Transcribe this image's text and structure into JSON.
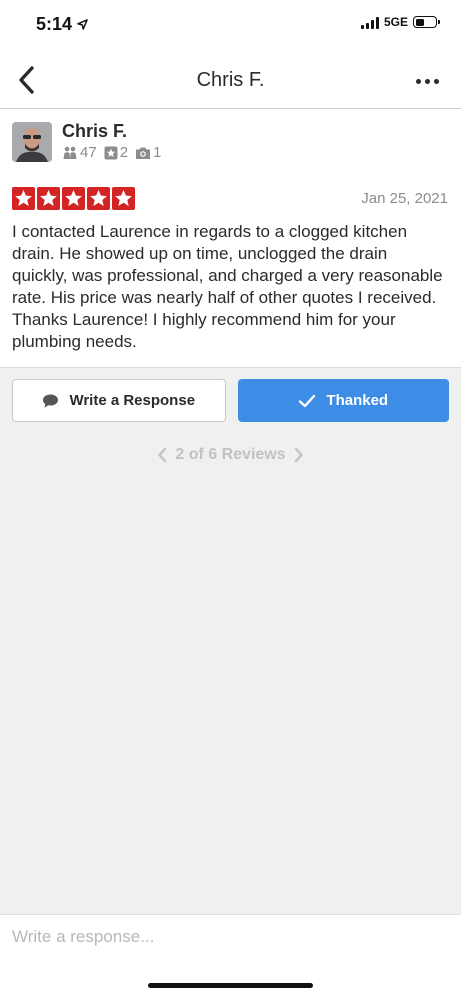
{
  "status_bar": {
    "time": "5:14",
    "network": "5GE",
    "battery_level": 0.45
  },
  "nav": {
    "title": "Chris F."
  },
  "review": {
    "user_name": "Chris F.",
    "stats": {
      "friends": "47",
      "reviews": "2",
      "photos": "1"
    },
    "rating": 5,
    "date": "Jan 25, 2021",
    "text": "I contacted Laurence in regards to a clogged kitchen drain. He showed up on time, unclogged the drain quickly, was professional, and charged a very reasonable rate. His price was nearly half of other quotes I received.  Thanks Laurence! I highly recommend him for your plumbing needs."
  },
  "actions": {
    "write_response_label": "Write a Response",
    "thanked_label": "Thanked"
  },
  "pager": {
    "label": "2 of 6 Reviews"
  },
  "composer": {
    "placeholder": "Write a response..."
  },
  "colors": {
    "star_red": "#d32323",
    "primary_blue": "#3d8de6",
    "muted_gray": "#8c8c8c"
  },
  "icons": {
    "location": "location-arrow-icon",
    "back": "chevron-left-icon",
    "more": "more-dots-icon",
    "friends": "friends-icon",
    "reviews": "review-star-icon",
    "photos": "camera-icon",
    "response": "speech-bubble-icon",
    "thanked": "checkmark-icon",
    "pager_prev": "chevron-left-icon",
    "pager_next": "chevron-right-icon"
  }
}
